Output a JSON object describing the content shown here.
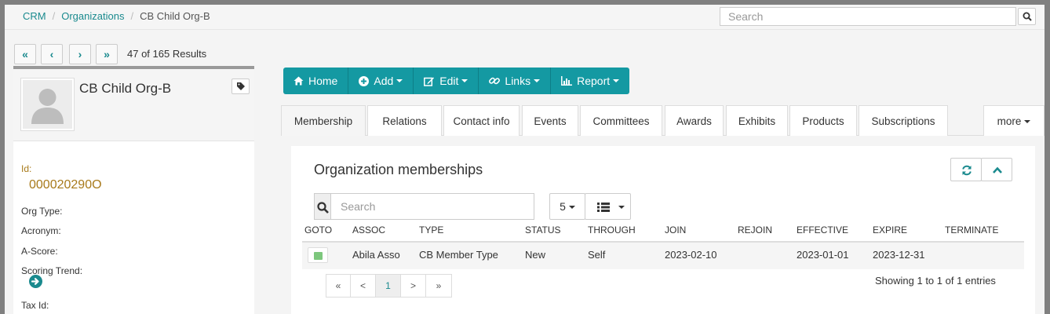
{
  "breadcrumb": {
    "root": "CRM",
    "parent": "Organizations",
    "current": "CB Child Org-B"
  },
  "top_search": {
    "placeholder": "Search"
  },
  "record_pager": {
    "first": "«",
    "prev": "‹",
    "next": "›",
    "last": "»",
    "results": "47 of 165 Results"
  },
  "org": {
    "name": "CB Child Org-B",
    "id_label": "Id:",
    "id_value": "000020290O",
    "fields": [
      "Org Type:",
      "Acronym:",
      "A-Score:",
      "Scoring Trend:",
      "Tax Id:"
    ]
  },
  "toolbar": {
    "home": "Home",
    "add": "Add",
    "edit": "Edit",
    "links": "Links",
    "report": "Report"
  },
  "tabs": [
    "Membership",
    "Relations",
    "Contact info",
    "Events",
    "Committees",
    "Awards",
    "Exhibits",
    "Products",
    "Subscriptions"
  ],
  "tab_more": "more",
  "panel": {
    "title": "Organization memberships",
    "search_placeholder": "Search",
    "page_size": "5",
    "columns": [
      "GOTO",
      "ASSOC",
      "TYPE",
      "STATUS",
      "THROUGH",
      "JOIN",
      "REJOIN",
      "EFFECTIVE",
      "EXPIRE",
      "TERMINATE"
    ],
    "rows": [
      {
        "assoc": "Abila Asso",
        "type": "CB Member Type",
        "status": "New",
        "through": "Self",
        "join": "2023-02-10",
        "rejoin": "",
        "effective": "2023-01-01",
        "expire": "2023-12-31",
        "terminate": ""
      }
    ],
    "pagination": {
      "first": "«",
      "prev": "<",
      "page": "1",
      "next": ">",
      "last": "»"
    },
    "showing": "Showing 1 to 1 of 1 entries"
  },
  "colors": {
    "accent": "#1499a2",
    "link": "#1a8a8e",
    "id": "#a87a1b"
  }
}
